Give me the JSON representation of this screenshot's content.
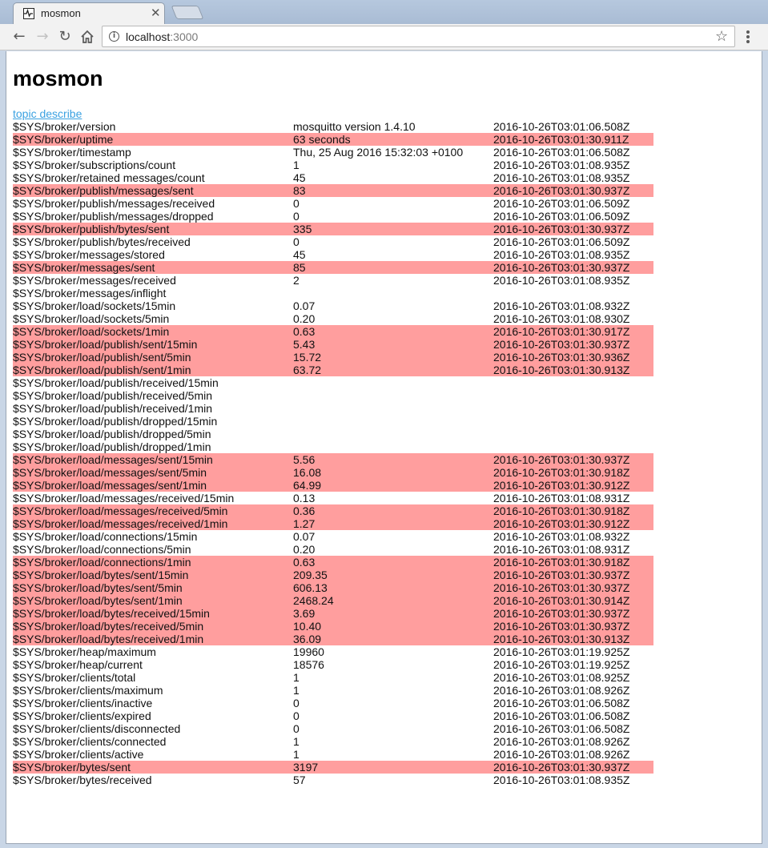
{
  "browser": {
    "tab_title": "mosmon",
    "tab_close": "✕",
    "url_host": "localhost",
    "url_port": ":3000"
  },
  "page": {
    "title": "mosmon",
    "link_text": "topic describe"
  },
  "colors": {
    "changed_row": "#ff9e9e",
    "link": "#3aa1e1"
  },
  "rows": [
    {
      "topic": "$SYS/broker/version",
      "value": "mosquitto version 1.4.10",
      "time": "2016-10-26T03:01:06.508Z",
      "changed": false
    },
    {
      "topic": "$SYS/broker/uptime",
      "value": "63 seconds",
      "time": "2016-10-26T03:01:30.911Z",
      "changed": true
    },
    {
      "topic": "$SYS/broker/timestamp",
      "value": "Thu, 25 Aug 2016 15:32:03 +0100",
      "time": "2016-10-26T03:01:06.508Z",
      "changed": false
    },
    {
      "topic": "$SYS/broker/subscriptions/count",
      "value": "1",
      "time": "2016-10-26T03:01:08.935Z",
      "changed": false
    },
    {
      "topic": "$SYS/broker/retained messages/count",
      "value": "45",
      "time": "2016-10-26T03:01:08.935Z",
      "changed": false
    },
    {
      "topic": "$SYS/broker/publish/messages/sent",
      "value": "83",
      "time": "2016-10-26T03:01:30.937Z",
      "changed": true
    },
    {
      "topic": "$SYS/broker/publish/messages/received",
      "value": "0",
      "time": "2016-10-26T03:01:06.509Z",
      "changed": false
    },
    {
      "topic": "$SYS/broker/publish/messages/dropped",
      "value": "0",
      "time": "2016-10-26T03:01:06.509Z",
      "changed": false
    },
    {
      "topic": "$SYS/broker/publish/bytes/sent",
      "value": "335",
      "time": "2016-10-26T03:01:30.937Z",
      "changed": true
    },
    {
      "topic": "$SYS/broker/publish/bytes/received",
      "value": "0",
      "time": "2016-10-26T03:01:06.509Z",
      "changed": false
    },
    {
      "topic": "$SYS/broker/messages/stored",
      "value": "45",
      "time": "2016-10-26T03:01:08.935Z",
      "changed": false
    },
    {
      "topic": "$SYS/broker/messages/sent",
      "value": "85",
      "time": "2016-10-26T03:01:30.937Z",
      "changed": true
    },
    {
      "topic": "$SYS/broker/messages/received",
      "value": "2",
      "time": "2016-10-26T03:01:08.935Z",
      "changed": false
    },
    {
      "topic": "$SYS/broker/messages/inflight",
      "value": "",
      "time": "",
      "changed": false
    },
    {
      "topic": "$SYS/broker/load/sockets/15min",
      "value": "0.07",
      "time": "2016-10-26T03:01:08.932Z",
      "changed": false
    },
    {
      "topic": "$SYS/broker/load/sockets/5min",
      "value": "0.20",
      "time": "2016-10-26T03:01:08.930Z",
      "changed": false
    },
    {
      "topic": "$SYS/broker/load/sockets/1min",
      "value": "0.63",
      "time": "2016-10-26T03:01:30.917Z",
      "changed": true
    },
    {
      "topic": "$SYS/broker/load/publish/sent/15min",
      "value": "5.43",
      "time": "2016-10-26T03:01:30.937Z",
      "changed": true
    },
    {
      "topic": "$SYS/broker/load/publish/sent/5min",
      "value": "15.72",
      "time": "2016-10-26T03:01:30.936Z",
      "changed": true
    },
    {
      "topic": "$SYS/broker/load/publish/sent/1min",
      "value": "63.72",
      "time": "2016-10-26T03:01:30.913Z",
      "changed": true
    },
    {
      "topic": "$SYS/broker/load/publish/received/15min",
      "value": "",
      "time": "",
      "changed": false
    },
    {
      "topic": "$SYS/broker/load/publish/received/5min",
      "value": "",
      "time": "",
      "changed": false
    },
    {
      "topic": "$SYS/broker/load/publish/received/1min",
      "value": "",
      "time": "",
      "changed": false
    },
    {
      "topic": "$SYS/broker/load/publish/dropped/15min",
      "value": "",
      "time": "",
      "changed": false
    },
    {
      "topic": "$SYS/broker/load/publish/dropped/5min",
      "value": "",
      "time": "",
      "changed": false
    },
    {
      "topic": "$SYS/broker/load/publish/dropped/1min",
      "value": "",
      "time": "",
      "changed": false
    },
    {
      "topic": "$SYS/broker/load/messages/sent/15min",
      "value": "5.56",
      "time": "2016-10-26T03:01:30.937Z",
      "changed": true
    },
    {
      "topic": "$SYS/broker/load/messages/sent/5min",
      "value": "16.08",
      "time": "2016-10-26T03:01:30.918Z",
      "changed": true
    },
    {
      "topic": "$SYS/broker/load/messages/sent/1min",
      "value": "64.99",
      "time": "2016-10-26T03:01:30.912Z",
      "changed": true
    },
    {
      "topic": "$SYS/broker/load/messages/received/15min",
      "value": "0.13",
      "time": "2016-10-26T03:01:08.931Z",
      "changed": false
    },
    {
      "topic": "$SYS/broker/load/messages/received/5min",
      "value": "0.36",
      "time": "2016-10-26T03:01:30.918Z",
      "changed": true
    },
    {
      "topic": "$SYS/broker/load/messages/received/1min",
      "value": "1.27",
      "time": "2016-10-26T03:01:30.912Z",
      "changed": true
    },
    {
      "topic": "$SYS/broker/load/connections/15min",
      "value": "0.07",
      "time": "2016-10-26T03:01:08.932Z",
      "changed": false
    },
    {
      "topic": "$SYS/broker/load/connections/5min",
      "value": "0.20",
      "time": "2016-10-26T03:01:08.931Z",
      "changed": false
    },
    {
      "topic": "$SYS/broker/load/connections/1min",
      "value": "0.63",
      "time": "2016-10-26T03:01:30.918Z",
      "changed": true
    },
    {
      "topic": "$SYS/broker/load/bytes/sent/15min",
      "value": "209.35",
      "time": "2016-10-26T03:01:30.937Z",
      "changed": true
    },
    {
      "topic": "$SYS/broker/load/bytes/sent/5min",
      "value": "606.13",
      "time": "2016-10-26T03:01:30.937Z",
      "changed": true
    },
    {
      "topic": "$SYS/broker/load/bytes/sent/1min",
      "value": "2468.24",
      "time": "2016-10-26T03:01:30.914Z",
      "changed": true
    },
    {
      "topic": "$SYS/broker/load/bytes/received/15min",
      "value": "3.69",
      "time": "2016-10-26T03:01:30.937Z",
      "changed": true
    },
    {
      "topic": "$SYS/broker/load/bytes/received/5min",
      "value": "10.40",
      "time": "2016-10-26T03:01:30.937Z",
      "changed": true
    },
    {
      "topic": "$SYS/broker/load/bytes/received/1min",
      "value": "36.09",
      "time": "2016-10-26T03:01:30.913Z",
      "changed": true
    },
    {
      "topic": "$SYS/broker/heap/maximum",
      "value": "19960",
      "time": "2016-10-26T03:01:19.925Z",
      "changed": false
    },
    {
      "topic": "$SYS/broker/heap/current",
      "value": "18576",
      "time": "2016-10-26T03:01:19.925Z",
      "changed": false
    },
    {
      "topic": "$SYS/broker/clients/total",
      "value": "1",
      "time": "2016-10-26T03:01:08.925Z",
      "changed": false
    },
    {
      "topic": "$SYS/broker/clients/maximum",
      "value": "1",
      "time": "2016-10-26T03:01:08.926Z",
      "changed": false
    },
    {
      "topic": "$SYS/broker/clients/inactive",
      "value": "0",
      "time": "2016-10-26T03:01:06.508Z",
      "changed": false
    },
    {
      "topic": "$SYS/broker/clients/expired",
      "value": "0",
      "time": "2016-10-26T03:01:06.508Z",
      "changed": false
    },
    {
      "topic": "$SYS/broker/clients/disconnected",
      "value": "0",
      "time": "2016-10-26T03:01:06.508Z",
      "changed": false
    },
    {
      "topic": "$SYS/broker/clients/connected",
      "value": "1",
      "time": "2016-10-26T03:01:08.926Z",
      "changed": false
    },
    {
      "topic": "$SYS/broker/clients/active",
      "value": "1",
      "time": "2016-10-26T03:01:08.926Z",
      "changed": false
    },
    {
      "topic": "$SYS/broker/bytes/sent",
      "value": "3197",
      "time": "2016-10-26T03:01:30.937Z",
      "changed": true
    },
    {
      "topic": "$SYS/broker/bytes/received",
      "value": "57",
      "time": "2016-10-26T03:01:08.935Z",
      "changed": false
    }
  ]
}
